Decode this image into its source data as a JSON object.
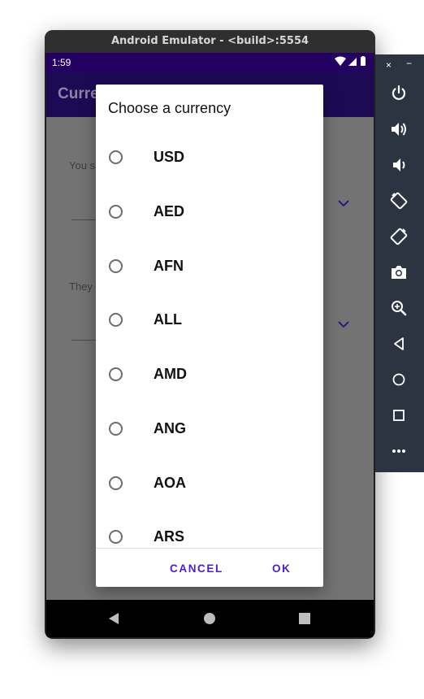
{
  "window": {
    "title": "Android Emulator - <build>:5554"
  },
  "status_bar": {
    "time": "1:59"
  },
  "app": {
    "title": "Curre",
    "you_send_label": "You s",
    "they_receive_label": "They"
  },
  "dialog": {
    "title": "Choose a currency",
    "currencies": [
      "USD",
      "AED",
      "AFN",
      "ALL",
      "AMD",
      "ANG",
      "AOA",
      "ARS"
    ],
    "cancel_label": "CANCEL",
    "ok_label": "OK"
  },
  "colors": {
    "status_bar": "#240063",
    "app_bar": "#1d0a55",
    "accent": "#4a1fd1",
    "scrim": "#737373",
    "toolbar": "#2b3440"
  },
  "toolbar": {
    "close": "×",
    "minimize": "−",
    "icons": [
      "power-icon",
      "volume-up-icon",
      "volume-down-icon",
      "rotate-left-icon",
      "rotate-right-icon",
      "camera-icon",
      "zoom-icon",
      "back-icon",
      "home-icon",
      "overview-icon",
      "more-icon"
    ]
  }
}
